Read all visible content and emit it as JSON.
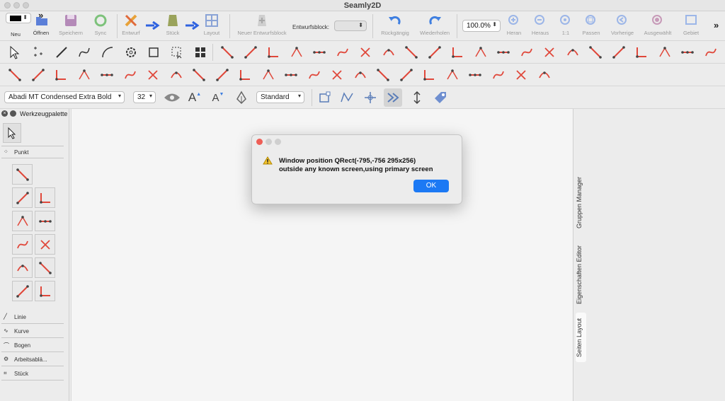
{
  "window": {
    "title": "Seamly2D"
  },
  "toolbar_main": {
    "new_label": "Neu",
    "open_label": "Öffnen",
    "save_label": "Speichern",
    "sync_label": "Sync",
    "draft_label": "Entwurf",
    "piece_label": "Stück",
    "layout_label": "Layout",
    "new_draft_block_label": "Neuer Entwurfsblock",
    "draft_block_field_label": "Entwurfsblock:",
    "draft_block_value": "",
    "undo_label": "Rückgängig",
    "redo_label": "Wiederholen",
    "zoom_value": "100.0%",
    "zoom_in_label": "Heran",
    "zoom_out_label": "Heraus",
    "zoom_1to1_label": "1:1",
    "zoom_fit_label": "Passen",
    "zoom_previous_label": "Vorherige",
    "zoom_selected_label": "Ausgewählt",
    "zoom_area_label": "Gebiet",
    "overflow_glyph": "»"
  },
  "toolbar_text": {
    "font_value": "Abadi MT Condensed Extra Bold",
    "size_value": "32",
    "line_type_value": "Standard",
    "text_glyph": "A"
  },
  "palette": {
    "title": "Werkzeugpalette",
    "tabs": [
      "Punkt",
      "Linie",
      "Kurve",
      "Bogen",
      "Arbeitsablä...",
      "Stück"
    ]
  },
  "dock": {
    "tabs": [
      "Gruppen Manager",
      "Eigenschaften Editor",
      "Seiten Layout"
    ]
  },
  "dialog": {
    "message_line1": "Window position QRect(-795,-756 295x256)",
    "message_line2": "outside any known screen,using primary screen",
    "ok_label": "OK"
  },
  "colors": {
    "accent_blue": "#1c79f4",
    "tool_red": "#e0473a",
    "dialog_close": "#ee5e56",
    "dialog_min": "#cfcfcf"
  }
}
